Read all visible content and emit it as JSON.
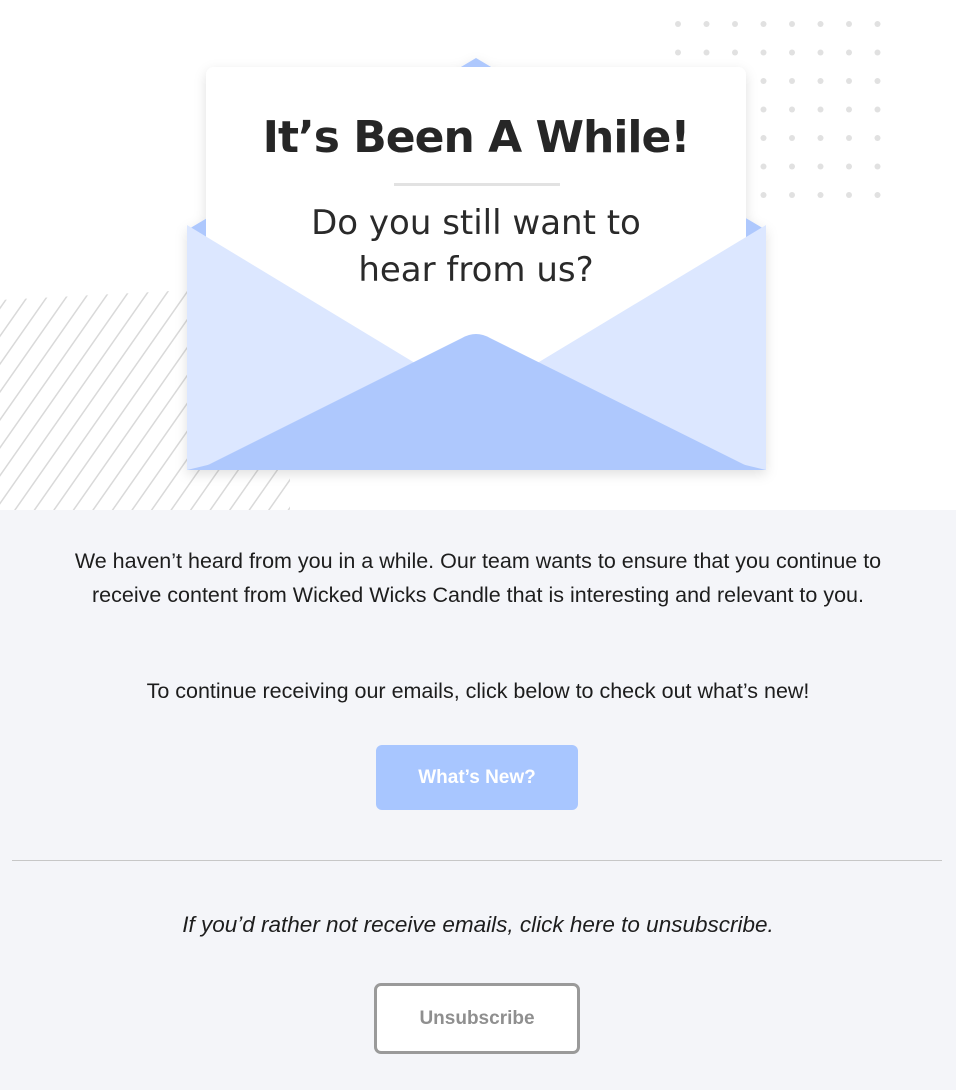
{
  "hero": {
    "title": "It’s Been A While!",
    "subtitle_line1": "Do you still want to",
    "subtitle_line2": "hear from us?"
  },
  "body": {
    "paragraph1": "We haven’t heard from you in a while. Our team wants to ensure that you continue to receive content from Wicked Wicks Candle that is interesting and relevant to you.",
    "paragraph2": "To continue receiving our emails, click below to check out what’s new!",
    "whats_new_label": "What’s New?",
    "unsubscribe_text": "If you’d rather not receive emails, click here to unsubscribe.",
    "unsubscribe_label": "Unsubscribe"
  },
  "colors": {
    "accent": "#a8c6ff",
    "envelope_light": "#dce7ff",
    "envelope_flap": "#aec8fd",
    "content_bg": "#f4f5f9"
  }
}
